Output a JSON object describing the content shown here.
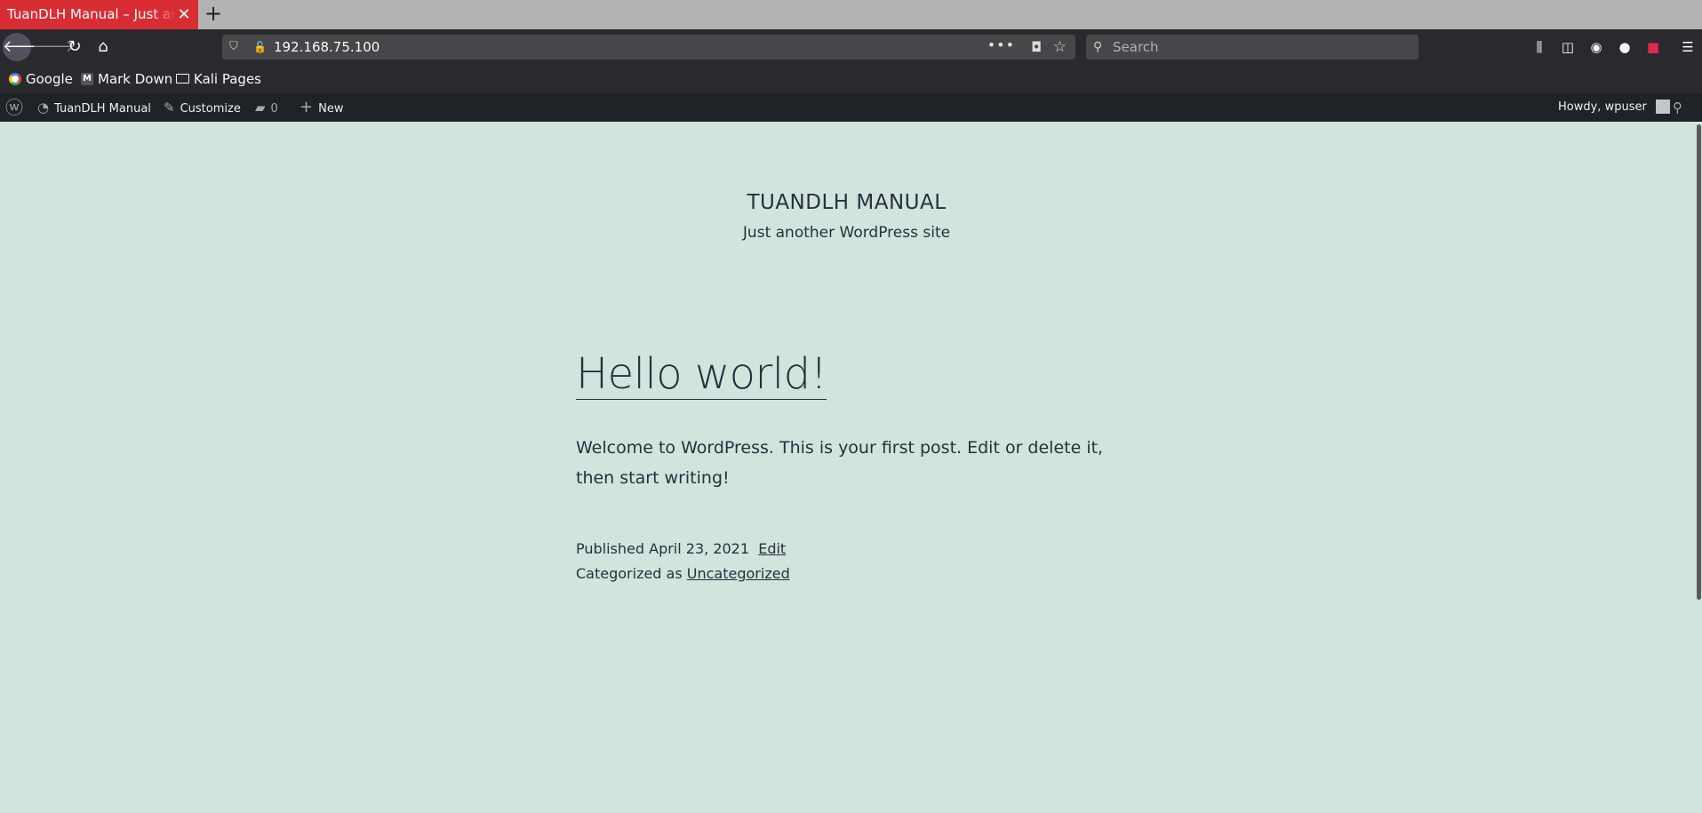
{
  "browser": {
    "tab_title": "TuanDLH Manual – Just another WordPress site",
    "url": "192.168.75.100",
    "search_placeholder": "Search",
    "bookmarks": [
      {
        "label": "Google",
        "icon": "google-icon"
      },
      {
        "label": "Mark Down",
        "icon": "markdown-icon"
      },
      {
        "label": "Kali Pages",
        "icon": "folder-icon"
      }
    ]
  },
  "admin_bar": {
    "site_name": "TuanDLH Manual",
    "customize": "Customize",
    "comments_count": "0",
    "new_label": "New",
    "howdy": "Howdy, wpuser"
  },
  "site": {
    "title": "TUANDLH MANUAL",
    "description": "Just another WordPress site"
  },
  "post": {
    "title": "Hello world!",
    "body": "Welcome to WordPress. This is your first post. Edit or delete it, then start writing!",
    "published_prefix": "Published",
    "date": "April 23, 2021",
    "edit_label": "Edit",
    "categorized_prefix": "Categorized as",
    "category": "Uncategorized"
  },
  "colors": {
    "tab_active": "#d92d34",
    "page_bg": "#d1e4dd",
    "admin_bar_bg": "#1d2327",
    "text": "#28303d"
  }
}
